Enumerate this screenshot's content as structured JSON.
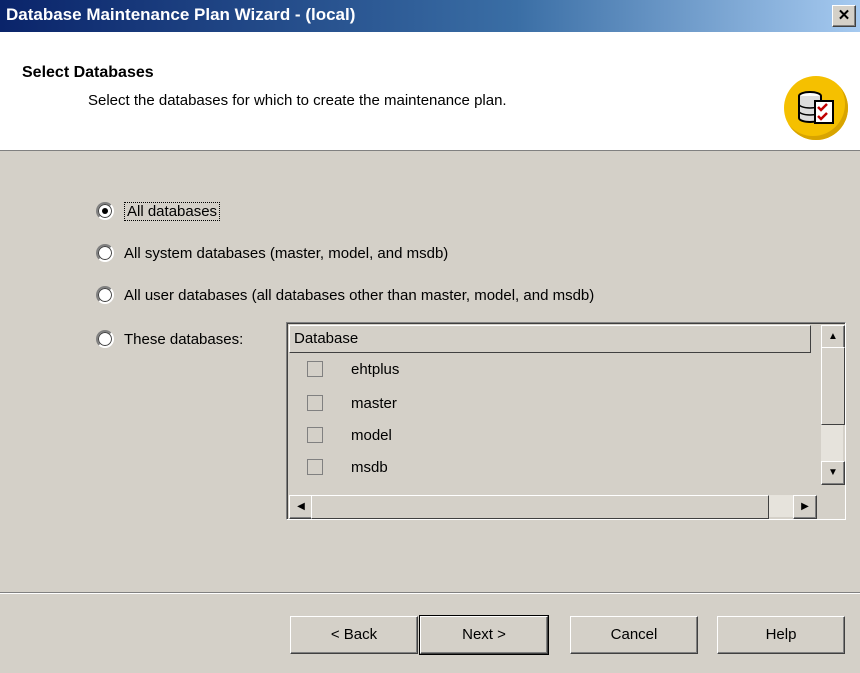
{
  "window": {
    "title": "Database Maintenance Plan Wizard - (local)",
    "close_label": "✕"
  },
  "header": {
    "title": "Select Databases",
    "subtitle": "Select the databases for which to create the maintenance plan."
  },
  "options": [
    {
      "label": "All databases",
      "selected": true
    },
    {
      "label": "All system databases (master, model, and msdb)",
      "selected": false
    },
    {
      "label": "All user databases (all databases other than master, model, and msdb)",
      "selected": false
    },
    {
      "label": "These databases:",
      "selected": false
    }
  ],
  "database_list": {
    "column_header": "Database",
    "rows": [
      "ehtplus",
      "master",
      "model",
      "msdb"
    ]
  },
  "buttons": {
    "back": "< Back",
    "next": "Next >",
    "cancel": "Cancel",
    "help": "Help"
  },
  "colors": {
    "titlebar": "#0a246a",
    "dialog": "#d4d0c8",
    "icon": "#f5c000"
  }
}
